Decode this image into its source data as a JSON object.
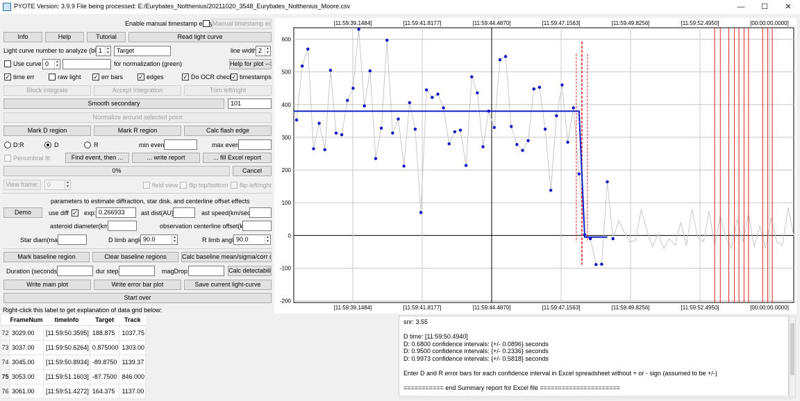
{
  "window": {
    "title": "PYOTE Version: 3.9.9  File being processed: E:/Eurybates_Nolthenius/20211020_3548_Eurybates_Nolthenius_Moore.csv",
    "minimize": "—",
    "maximize": "☐",
    "close": "✕"
  },
  "controls": {
    "manual_ts_entry_label": "Enable manual timestamp entry",
    "manual_ts_entry_button": "Manual timestamp entry",
    "info": "Info",
    "help": "Help",
    "tutorial": "Tutorial",
    "read_light_curve": "Read light curve",
    "lc_number_label": "Light curve number to analyze (blue):",
    "lc_number": "1",
    "lc_name": "Target",
    "line_width_label": "line width",
    "line_width": "2",
    "use_curve": "Use curve",
    "use_curve_num": "0",
    "for_normalization": "for normalization (green)",
    "help_for_plot": "Help for plot -->",
    "time_err": "time err",
    "raw_light": "raw light",
    "err_bars": "err bars",
    "edges": "edges",
    "do_ocr_check": "Do OCR check",
    "timestamps": "timestamps",
    "block_integrate": "Block integrate",
    "accept_integration": "Accept Integration",
    "trim": "Trim left/right",
    "smooth_secondary": "Smooth secondary",
    "smooth_value": "101",
    "normalize": "Normalize around selected point",
    "mark_d": "Mark D region",
    "mark_r": "Mark R region",
    "calc_flash": "Calc flash edge",
    "radio_dr": "D:R",
    "radio_d": "D",
    "radio_r": "R",
    "min_event": "min event:",
    "max_event": "max event:",
    "penumbral_fit": "Penumbral fit",
    "find_event": "Find event, then ...",
    "write_report": "... write report",
    "fill_excel": "... fill Excel report",
    "progress": "0%",
    "cancel": "Cancel",
    "view_frame": "View frame:",
    "view_frame_num": "0",
    "field_view": "field view",
    "flip_tb": "flip top/bottom",
    "flip_lr": "flip left/right",
    "params_header": "parameters to estimate diffraction, star disk, and centerline offset effects",
    "demo": "Demo",
    "use_diff": "use diff",
    "exp_label": "exp:",
    "exp_value": "0.266933",
    "ast_dist": "ast dist(AU):",
    "ast_speed": "ast speed(km/sec):",
    "ast_diam": "asteroid diameter(km):",
    "obs_offset": "observation centerline offset(km):",
    "star_diam": "Star diam(mas):",
    "d_limb": "D limb angle:",
    "d_limb_val": "90.0",
    "r_limb": "R limb angle:",
    "r_limb_val": "90.0",
    "mark_baseline": "Mark baseline region",
    "clear_baseline": "Clear baseline regions",
    "calc_baseline": "Calc baseline mean/sigma/corr coeffs",
    "duration": "Duration (seconds):",
    "dur_step": "dur step",
    "mag_drop": "magDrop:",
    "calc_detect": "Calc detectability",
    "write_main": "Write main plot",
    "write_err": "Write error bar plot",
    "save_lc": "Save current light-curve",
    "start_over": "Start over",
    "grid_hint": "Right-click this label to get explanation of data grid below:"
  },
  "table": {
    "headers": [
      "FrameNum",
      "timeInfo",
      "Target",
      "Track"
    ],
    "rows": [
      {
        "idx": "72",
        "frame": "3029.00",
        "time": "[11:59:50.3595]",
        "target": "188.875",
        "track": "1037.75"
      },
      {
        "idx": "73",
        "frame": "3037.00",
        "time": "[11:59:50.6264]",
        "target": "0.875000",
        "track": "1303.00"
      },
      {
        "idx": "74",
        "frame": "3045.00",
        "time": "[11:59:50.8934]",
        "target": "-89.8750",
        "track": "1139.37"
      },
      {
        "idx": "75",
        "frame": "3053.00",
        "time": "[11:59:51.1603]",
        "target": "-87.7500",
        "track": "846.000"
      },
      {
        "idx": "76",
        "frame": "3061.00",
        "time": "[11:59:51.4272]",
        "target": "164.375",
        "track": "1137.00"
      }
    ]
  },
  "report": {
    "lines": [
      "snr: 3.55",
      "",
      "D time: [11:59:50.4940]",
      "D: 0.6800 confidence intervals: {+/- 0.0896} seconds",
      "D: 0.9500 confidence intervals: {+/- 0.2336} seconds",
      "D: 0.9973 confidence intervals: {+/- 0.5818} seconds",
      "",
      "Enter D and R error bars for each confidence interval in Excel spreadsheet without + or - sign (assumed to be +/-)",
      "",
      "=========== end Summary report for Excel file ======================"
    ]
  },
  "chart_data": {
    "type": "scatter",
    "title": "",
    "xlabel": "",
    "ylabel": "",
    "x_tick_labels": [
      "[11:59:39.1484]",
      "[11:59:41.8177]",
      "[11:59:44.4870]",
      "[11:59:47.1563]",
      "[11:59:49.8256]",
      "[11:59:52.4950]",
      "[00:00:00.0000]"
    ],
    "y_ticks": [
      600,
      500,
      400,
      300,
      200,
      100,
      0,
      -100,
      -200
    ],
    "ylim": [
      -205,
      635
    ],
    "grid": true,
    "colors": {
      "points": "#1010c8",
      "trace": "#c8c8c8",
      "fit": "#1020c8",
      "edge": "#e02020",
      "axis": "#000000"
    },
    "series": [
      {
        "x": [
          0,
          1,
          2,
          3,
          4,
          5,
          6,
          7,
          8,
          9,
          10,
          11,
          12,
          13,
          14,
          15,
          16,
          17,
          18,
          19,
          20,
          21,
          22,
          23,
          24,
          25,
          26,
          27,
          28,
          29,
          30,
          31,
          32,
          33,
          34,
          35,
          36,
          37,
          38,
          39,
          40,
          41,
          42,
          43,
          44,
          45,
          46,
          47,
          48,
          49,
          50,
          51,
          52,
          53,
          54,
          55,
          56,
          57,
          58
        ],
        "y": [
          353,
          518,
          570,
          265,
          343,
          262,
          505,
          313,
          308,
          413,
          450,
          630,
          396,
          503,
          235,
          328,
          597,
          313,
          356,
          212,
          406,
          325,
          70,
          445,
          422,
          432,
          390,
          280,
          317,
          322,
          214,
          485,
          436,
          271,
          380,
          330,
          537,
          547,
          333,
          278,
          260,
          290,
          448,
          453,
          325,
          138,
          366,
          460,
          285,
          390,
          188,
          2,
          -10,
          -89,
          -88,
          164,
          -10,
          null,
          null
        ]
      }
    ],
    "extra_trace": [
      45,
      10,
      -20,
      -15,
      80,
      15,
      -35,
      5,
      -40,
      -10,
      -30,
      40,
      -30,
      80,
      -5,
      -20,
      75,
      -30,
      60,
      -10,
      -40,
      50,
      -20,
      65,
      -35,
      30,
      -40,
      55,
      -20,
      -30,
      85,
      0
    ],
    "baseline_level": 380,
    "event_level": -5,
    "d_edge_index": 50.5
  }
}
